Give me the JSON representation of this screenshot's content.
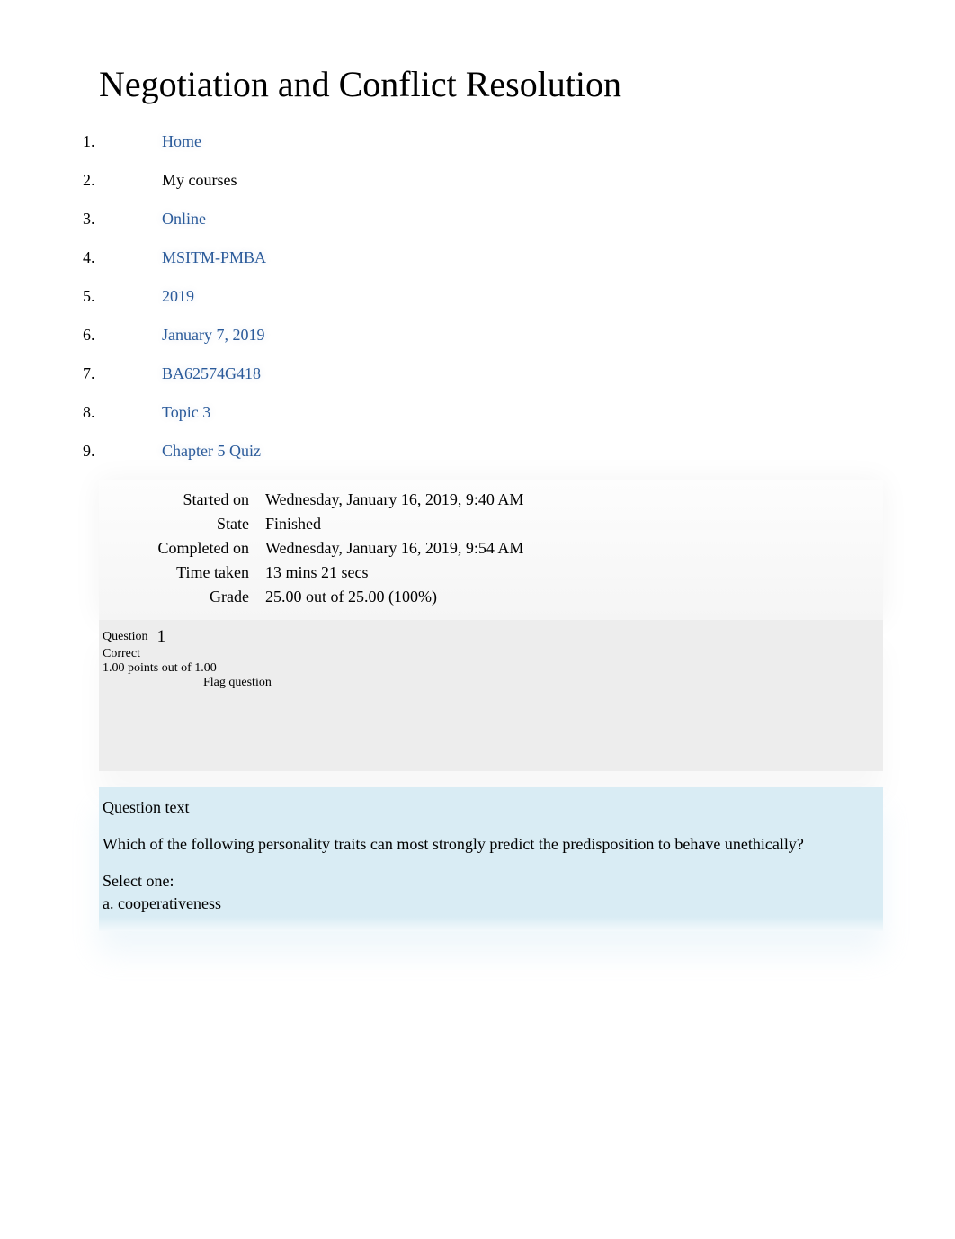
{
  "page_title": "Negotiation and Conflict Resolution",
  "breadcrumb": {
    "items": [
      {
        "label": "Home",
        "is_link": true
      },
      {
        "label": "My courses",
        "is_link": false
      },
      {
        "label": "Online",
        "is_link": true
      },
      {
        "label": "MSITM-PMBA",
        "is_link": true
      },
      {
        "label": "2019",
        "is_link": true
      },
      {
        "label": "January 7, 2019",
        "is_link": true
      },
      {
        "label": "BA62574G418",
        "is_link": true
      },
      {
        "label": "Topic 3",
        "is_link": true
      },
      {
        "label": "Chapter 5 Quiz",
        "is_link": true
      }
    ]
  },
  "summary": {
    "rows": [
      {
        "label": "Started on",
        "value": "Wednesday, January 16, 2019, 9:40 AM"
      },
      {
        "label": "State",
        "value": "Finished"
      },
      {
        "label": "Completed on",
        "value": "Wednesday, January 16, 2019, 9:54 AM"
      },
      {
        "label": "Time taken",
        "value": "13 mins 21 secs"
      },
      {
        "label": "Grade",
        "value": "25.00 out of 25.00 (100%)"
      }
    ]
  },
  "question": {
    "label": "Question",
    "number": "1",
    "status": "Correct",
    "points": "1.00 points out of 1.00",
    "flag_label": "Flag question",
    "heading": "Question text",
    "body": "Which of the following personality traits can most strongly predict the predisposition to behave unethically?",
    "select_one": "Select one:",
    "options": [
      {
        "letter": "a.",
        "text": "cooperativeness"
      }
    ]
  }
}
